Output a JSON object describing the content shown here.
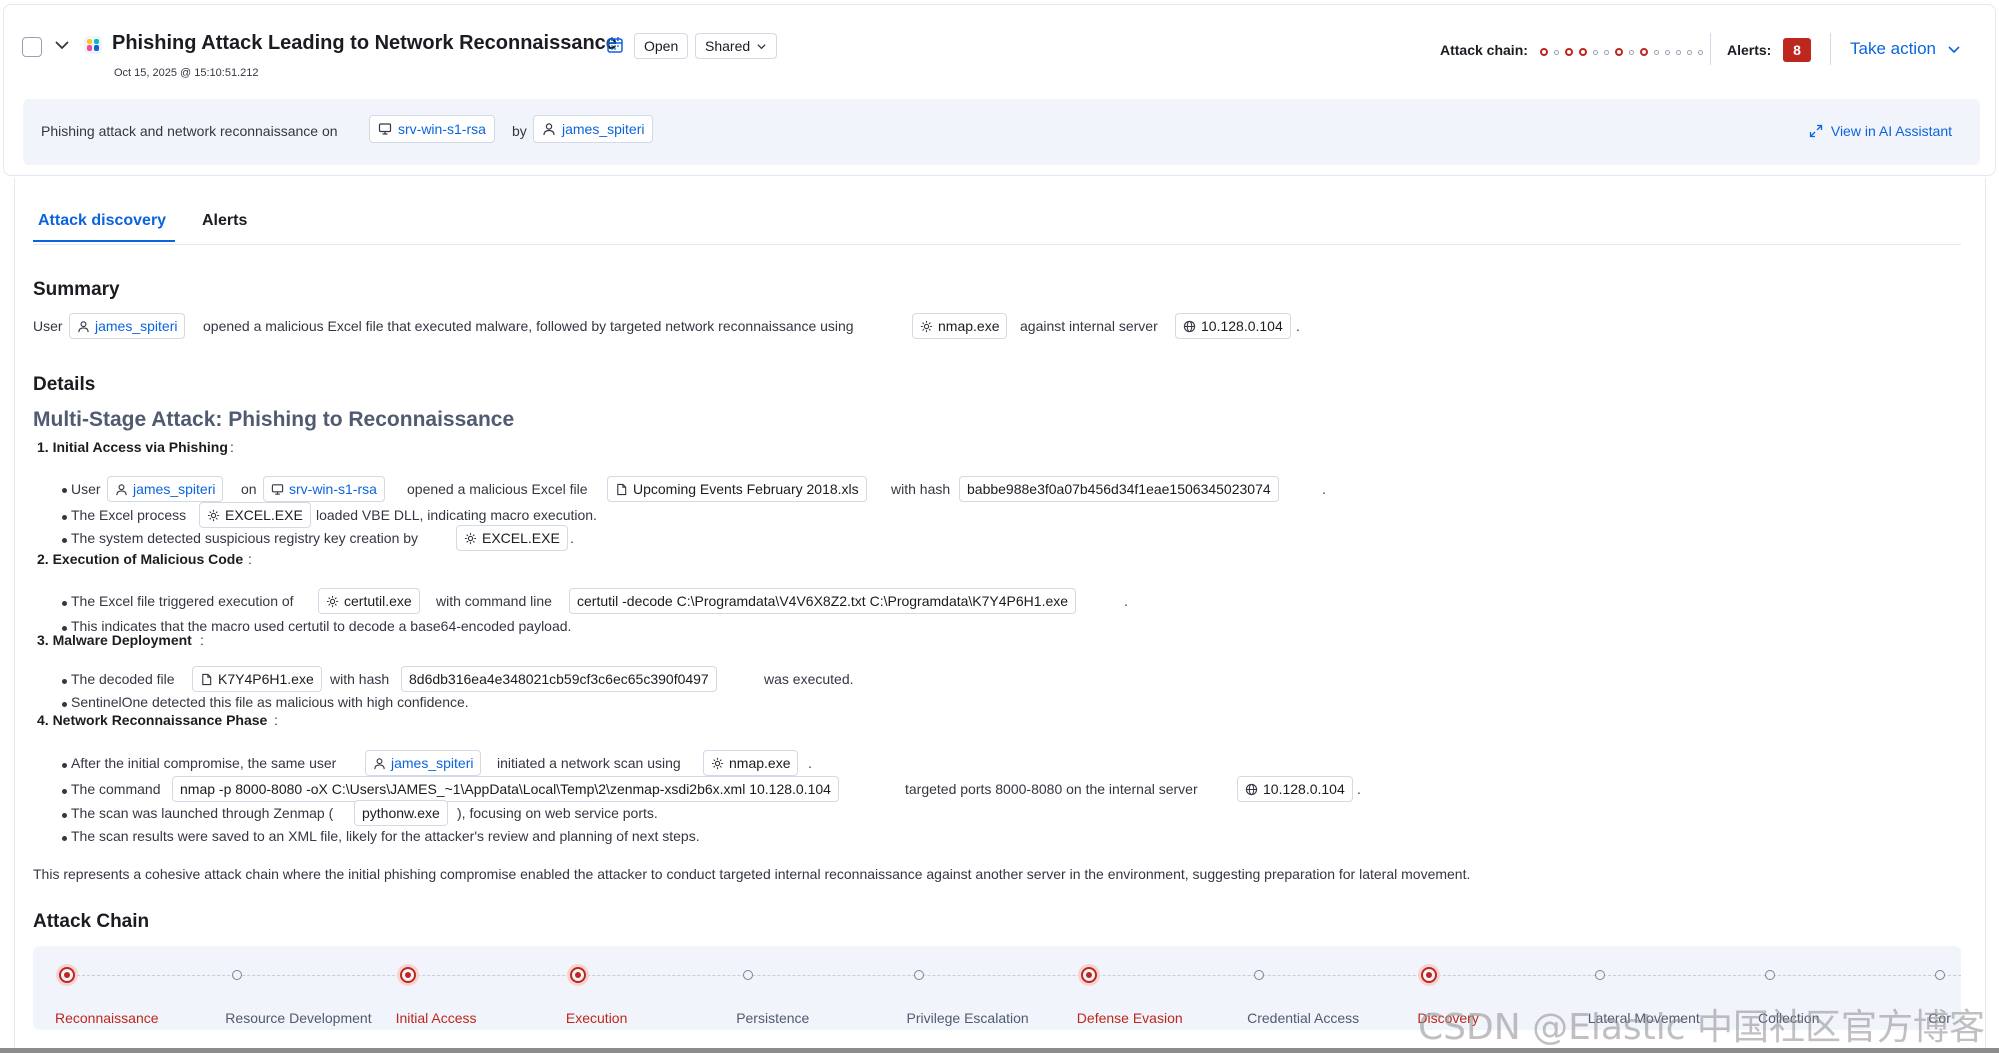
{
  "header": {
    "title": "Phishing Attack Leading to Network Reconnaissance",
    "timestamp": "Oct 15, 2025 @ 15:10:51.212",
    "status_label": "Open",
    "visibility_label": "Shared",
    "attack_chain_label": "Attack chain:",
    "attack_chain_markers": [
      "on",
      "off",
      "on",
      "on",
      "off",
      "off",
      "on",
      "off",
      "on",
      "off",
      "off",
      "off",
      "off",
      "off"
    ],
    "alerts_label": "Alerts:",
    "alerts_count": "8",
    "take_action_label": "Take action"
  },
  "summary_strip": {
    "prefix": "Phishing attack and network reconnaissance on",
    "host": "srv-win-s1-rsa",
    "by": "by",
    "user": "james_spiteri",
    "view_ai_label": "View in AI Assistant"
  },
  "tabs": [
    {
      "label": "Attack discovery",
      "active": true
    },
    {
      "label": "Alerts",
      "active": false
    }
  ],
  "summary": {
    "heading": "Summary",
    "t1": "User",
    "user": "james_spiteri",
    "t2": "opened a malicious Excel file that executed malware, followed by targeted network reconnaissance using",
    "process": "nmap.exe",
    "t3": "against internal server",
    "ip": "10.128.0.104",
    "t4": "."
  },
  "details": {
    "heading": "Details",
    "subheading": "Multi-Stage Attack: Phishing to Reconnaissance",
    "s1_title": "1. Initial Access via Phishing",
    "s1_b1_t1": "User",
    "s1_b1_user": "james_spiteri",
    "s1_b1_t2": "on",
    "s1_b1_host": "srv-win-s1-rsa",
    "s1_b1_t3": "opened a malicious Excel file",
    "s1_b1_file": "Upcoming Events February 2018.xls",
    "s1_b1_t4": "with hash",
    "s1_b1_hash": "babbe988e3f0a07b456d34f1eae1506345023074",
    "s1_b2_t1": "The Excel process",
    "s1_b2_proc": "EXCEL.EXE",
    "s1_b2_t2": "loaded VBE DLL, indicating macro execution.",
    "s1_b3_t1": "The system detected suspicious registry key creation by",
    "s1_b3_proc": "EXCEL.EXE",
    "s2_title": "2. Execution of Malicious Code",
    "s2_b1_t1": "The Excel file triggered execution of",
    "s2_b1_proc": "certutil.exe",
    "s2_b1_t2": "with command line",
    "s2_b1_cmd": "certutil -decode C:\\Programdata\\V4V6X8Z2.txt C:\\Programdata\\K7Y4P6H1.exe",
    "s2_b2": "This indicates that the macro used certutil to decode a base64-encoded payload.",
    "s3_title": "3. Malware Deployment",
    "s3_b1_t1": "The decoded file",
    "s3_b1_file": "K7Y4P6H1.exe",
    "s3_b1_t2": "with hash",
    "s3_b1_hash": "8d6db316ea4e348021cb59cf3c6ec65c390f0497",
    "s3_b1_t3": "was executed.",
    "s3_b2": "SentinelOne detected this file as malicious with high confidence.",
    "s4_title": "4. Network Reconnaissance Phase",
    "s4_b1_t1": "After the initial compromise, the same user",
    "s4_b1_user": "james_spiteri",
    "s4_b1_t2": "initiated a network scan using",
    "s4_b1_proc": "nmap.exe",
    "s4_b2_t1": "The command",
    "s4_b2_cmd": "nmap -p 8000-8080 -oX C:\\Users\\JAMES_~1\\AppData\\Local\\Temp\\2\\zenmap-xsdi2b6x.xml 10.128.0.104",
    "s4_b2_t2": "targeted ports 8000-8080 on the internal server",
    "s4_b2_ip": "10.128.0.104",
    "s4_b3_t1": "The scan was launched through Zenmap (",
    "s4_b3_proc": "pythonw.exe",
    "s4_b3_t2": "), focusing on web service ports.",
    "s4_b4": "The scan results were saved to an XML file, likely for the attacker's review and planning of next steps.",
    "conclusion": "This represents a cohesive attack chain where the initial phishing compromise enabled the attacker to conduct targeted internal reconnaissance against another server in the environment, suggesting preparation for lateral movement."
  },
  "attack_chain": {
    "heading": "Attack Chain",
    "stages": [
      {
        "label": "Reconnaissance",
        "detected": true
      },
      {
        "label": "Resource Development",
        "detected": false
      },
      {
        "label": "Initial Access",
        "detected": true
      },
      {
        "label": "Execution",
        "detected": true
      },
      {
        "label": "Persistence",
        "detected": false
      },
      {
        "label": "Privilege Escalation",
        "detected": false
      },
      {
        "label": "Defense Evasion",
        "detected": true
      },
      {
        "label": "Credential Access",
        "detected": false
      },
      {
        "label": "Discovery",
        "detected": true
      },
      {
        "label": "Lateral Movement",
        "detected": false
      },
      {
        "label": "Collection",
        "detected": false
      },
      {
        "label": "Cor",
        "detected": false
      }
    ]
  },
  "colors": {
    "accent": "#0b64dd",
    "danger": "#bd271e",
    "text": "#343741",
    "panel_bg": "#f1f4fa"
  },
  "icons": [
    "chevron-down-icon",
    "ai-logo-icon",
    "calendar-icon",
    "host-icon",
    "user-icon",
    "process-gear-icon",
    "file-icon",
    "globe-icon",
    "expand-arrows-icon"
  ],
  "watermark": "CSDN @Elastic 中国社区官方博客"
}
